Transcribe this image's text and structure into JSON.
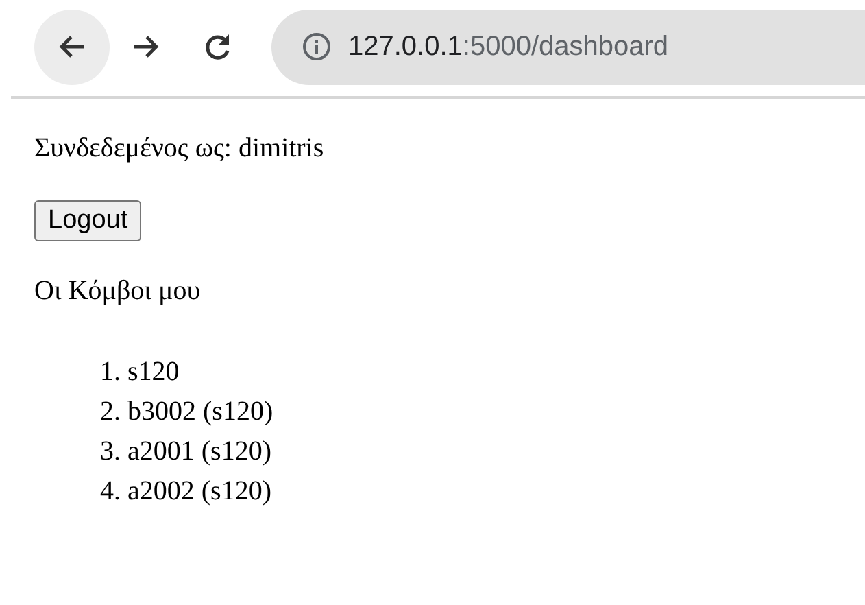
{
  "browser": {
    "url_host": "127.0.0.1",
    "url_rest": ":5000/dashboard"
  },
  "logged_in_label": "Συνδεδεμένος ως: dimitris",
  "logout_button": "Logout",
  "nodes_heading": "Οι Κόμβοι μου",
  "nodes": [
    {
      "marker": "1.",
      "text": "s120"
    },
    {
      "marker": "2.",
      "text": "b3002 (s120)"
    },
    {
      "marker": "3.",
      "text": "a2001 (s120)"
    },
    {
      "marker": "4.",
      "text": "a2002 (s120)"
    }
  ]
}
